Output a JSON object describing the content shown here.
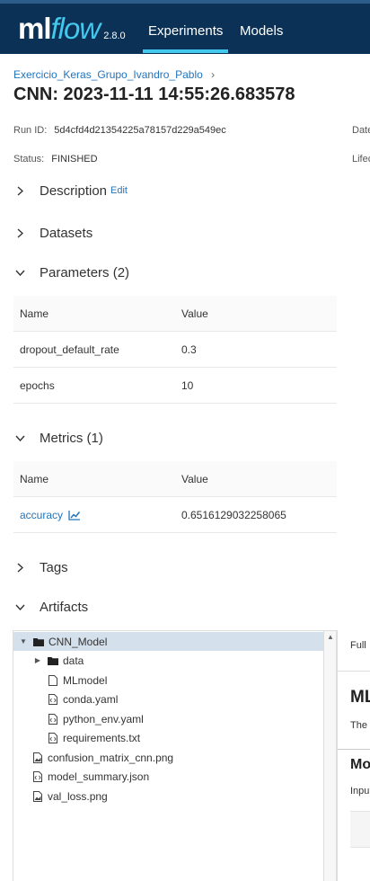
{
  "header": {
    "logo_ml": "ml",
    "logo_flow": "flow",
    "version": "2.8.0",
    "nav": [
      {
        "label": "Experiments",
        "active": true
      },
      {
        "label": "Models",
        "active": false
      }
    ],
    "accent_color": "#43c9ed",
    "bar_color": "#0b3157"
  },
  "breadcrumb": {
    "experiment": "Exercicio_Keras_Grupo_Ivandro_Pablo",
    "separator": "›"
  },
  "run": {
    "title": "CNN: 2023-11-11 14:55:26.683578",
    "run_id_label": "Run ID:",
    "run_id": "5d4cfd4d21354225a78157d229a549ec",
    "date_label": "Date",
    "status_label": "Status:",
    "status": "FINISHED",
    "lifecycle_label": "Lifec"
  },
  "sections": {
    "description": {
      "label": "Description",
      "edit": "Edit"
    },
    "datasets": {
      "label": "Datasets"
    },
    "parameters": {
      "label": "Parameters (2)"
    },
    "metrics": {
      "label": "Metrics (1)"
    },
    "tags": {
      "label": "Tags"
    },
    "artifacts": {
      "label": "Artifacts"
    }
  },
  "parameters_table": {
    "headers": [
      "Name",
      "Value"
    ],
    "rows": [
      {
        "name": "dropout_default_rate",
        "value": "0.3"
      },
      {
        "name": "epochs",
        "value": "10"
      }
    ]
  },
  "metrics_table": {
    "headers": [
      "Name",
      "Value"
    ],
    "rows": [
      {
        "name": "accuracy",
        "value": "0.6516129032258065"
      }
    ]
  },
  "artifacts_tree": [
    {
      "label": "CNN_Model",
      "type": "folder",
      "expanded": true,
      "selected": true
    },
    {
      "label": "data",
      "type": "folder",
      "expanded": false
    },
    {
      "label": "MLmodel",
      "type": "file"
    },
    {
      "label": "conda.yaml",
      "type": "code-file"
    },
    {
      "label": "python_env.yaml",
      "type": "code-file"
    },
    {
      "label": "requirements.txt",
      "type": "code-file"
    },
    {
      "label": "confusion_matrix_cnn.png",
      "type": "image-file"
    },
    {
      "label": "model_summary.json",
      "type": "code-file"
    },
    {
      "label": "val_loss.png",
      "type": "image-file"
    }
  ],
  "artifact_preview": {
    "full_path": "Full",
    "heading": "ML",
    "text": "The",
    "subheading": "Mo",
    "input": "Inpu"
  }
}
